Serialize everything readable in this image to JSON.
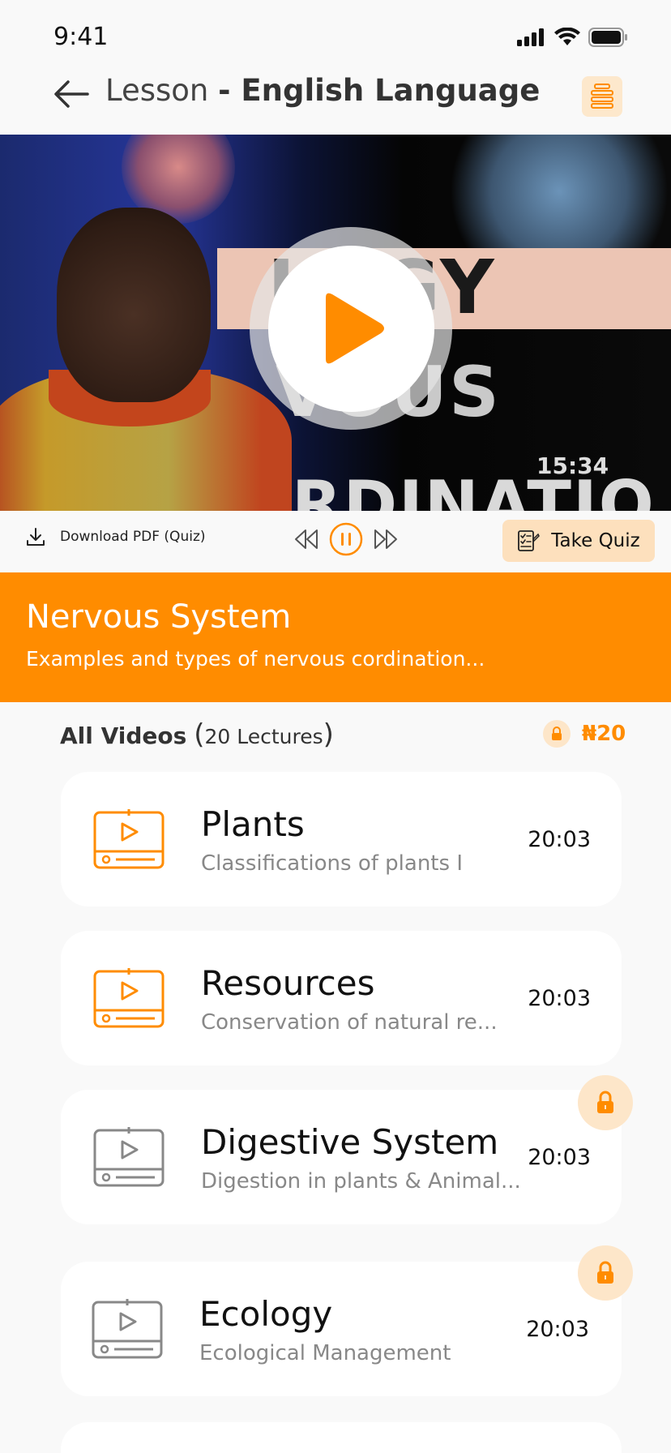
{
  "status_bar": {
    "time": "9:41"
  },
  "header": {
    "title_light": "Lesson",
    "title_bold": "- English Language"
  },
  "video": {
    "overlay_line1": "LOGY",
    "overlay_line2": "VOUS",
    "overlay_line3": "RDINATIO",
    "timecode": "15:34"
  },
  "controls": {
    "download_label": "Download PDF (Quiz)",
    "take_quiz_label": "Take Quiz"
  },
  "topic": {
    "title": "Nervous System",
    "description": "Examples and types of nervous cordination..."
  },
  "list": {
    "heading": "All Videos",
    "open_paren": "(",
    "count": "20 Lectures",
    "close_paren": ")",
    "price": "₦20"
  },
  "lectures": [
    {
      "title": "Plants",
      "subtitle": "Classifications of plants I",
      "duration": "20:03",
      "locked": false
    },
    {
      "title": "Resources",
      "subtitle": "Conservation of natural re...",
      "duration": "20:03",
      "locked": false
    },
    {
      "title": "Digestive System",
      "subtitle": "Digestion in plants & Animal...",
      "duration": "20:03",
      "locked": true
    },
    {
      "title": "Ecology",
      "subtitle": "Ecological Management",
      "duration": "20:03",
      "locked": true
    }
  ],
  "colors": {
    "accent": "#ff8c00",
    "accent_light": "#fde6c9",
    "locked_icon": "#888888",
    "background": "#f9f9f9"
  }
}
